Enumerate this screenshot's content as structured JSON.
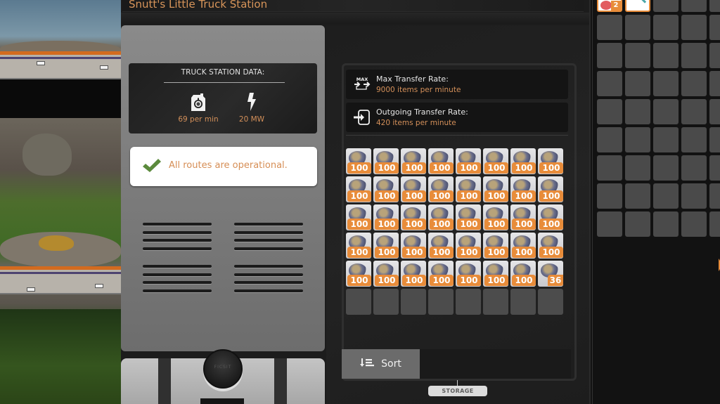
{
  "window": {
    "title": "Snutt's Little Truck Station"
  },
  "station_data": {
    "header": "TRUCK STATION DATA:",
    "fuel": {
      "icon": "fuel-canister-timer-icon",
      "value": "69 per min"
    },
    "power": {
      "icon": "lightning-bolt-icon",
      "value": "20 MW"
    }
  },
  "status": {
    "icon": "checkmark-icon",
    "message": "All routes are operational.",
    "check_color": "#5b8a3c",
    "text_color": "#d68e55"
  },
  "transfer": {
    "max": {
      "icon": "max-transfer-icon",
      "label": "Max Transfer Rate:",
      "value": "9000 items per minute"
    },
    "outgoing": {
      "icon": "outgoing-transfer-icon",
      "label": "Outgoing Transfer Rate:",
      "value": "420 items per minute"
    }
  },
  "storage": {
    "columns": 8,
    "slots": [
      {
        "item": "ore",
        "count": "100"
      },
      {
        "item": "ore",
        "count": "100"
      },
      {
        "item": "ore",
        "count": "100"
      },
      {
        "item": "ore",
        "count": "100"
      },
      {
        "item": "ore",
        "count": "100"
      },
      {
        "item": "ore",
        "count": "100"
      },
      {
        "item": "ore",
        "count": "100"
      },
      {
        "item": "ore",
        "count": "100"
      },
      {
        "item": "ore",
        "count": "100"
      },
      {
        "item": "ore",
        "count": "100"
      },
      {
        "item": "ore",
        "count": "100"
      },
      {
        "item": "ore",
        "count": "100"
      },
      {
        "item": "ore",
        "count": "100"
      },
      {
        "item": "ore",
        "count": "100"
      },
      {
        "item": "ore",
        "count": "100"
      },
      {
        "item": "ore",
        "count": "100"
      },
      {
        "item": "ore",
        "count": "100"
      },
      {
        "item": "ore",
        "count": "100"
      },
      {
        "item": "ore",
        "count": "100"
      },
      {
        "item": "ore",
        "count": "100"
      },
      {
        "item": "ore",
        "count": "100"
      },
      {
        "item": "ore",
        "count": "100"
      },
      {
        "item": "ore",
        "count": "100"
      },
      {
        "item": "ore",
        "count": "100"
      },
      {
        "item": "ore",
        "count": "100"
      },
      {
        "item": "ore",
        "count": "100"
      },
      {
        "item": "ore",
        "count": "100"
      },
      {
        "item": "ore",
        "count": "100"
      },
      {
        "item": "ore",
        "count": "100"
      },
      {
        "item": "ore",
        "count": "100"
      },
      {
        "item": "ore",
        "count": "100"
      },
      {
        "item": "ore",
        "count": "100"
      },
      {
        "item": "ore",
        "count": "100"
      },
      {
        "item": "ore",
        "count": "100"
      },
      {
        "item": "ore",
        "count": "100"
      },
      {
        "item": "ore",
        "count": "100"
      },
      {
        "item": "ore",
        "count": "100"
      },
      {
        "item": "ore",
        "count": "100"
      },
      {
        "item": "ore",
        "count": "100"
      },
      {
        "item": "ore",
        "count": "36"
      },
      {
        "item": null,
        "count": null
      },
      {
        "item": null,
        "count": null
      },
      {
        "item": null,
        "count": null
      },
      {
        "item": null,
        "count": null
      },
      {
        "item": null,
        "count": null
      },
      {
        "item": null,
        "count": null
      },
      {
        "item": null,
        "count": null
      },
      {
        "item": null,
        "count": null
      }
    ],
    "sort_label": "Sort",
    "tag": "STORAGE"
  },
  "inventory": {
    "slots": [
      {
        "item": "meat",
        "count": "2"
      },
      {
        "item": "pickaxe",
        "count": null
      },
      {
        "item": null
      },
      {
        "item": null
      },
      {
        "item": null
      },
      {
        "item": null
      },
      {
        "item": null
      },
      {
        "item": null
      },
      {
        "item": null
      },
      {
        "item": null
      },
      {
        "item": null
      },
      {
        "item": null
      },
      {
        "item": null
      },
      {
        "item": null
      },
      {
        "item": null
      },
      {
        "item": null
      },
      {
        "item": null
      },
      {
        "item": null
      },
      {
        "item": null
      },
      {
        "item": null
      },
      {
        "item": null
      },
      {
        "item": null
      },
      {
        "item": null
      },
      {
        "item": null
      },
      {
        "item": null
      },
      {
        "item": null
      },
      {
        "item": null
      },
      {
        "item": null
      },
      {
        "item": null
      },
      {
        "item": null
      },
      {
        "item": null
      },
      {
        "item": null
      },
      {
        "item": null
      },
      {
        "item": null
      },
      {
        "item": null
      },
      {
        "item": null
      },
      {
        "item": null
      },
      {
        "item": null
      },
      {
        "item": null
      },
      {
        "item": null
      },
      {
        "item": null
      },
      {
        "item": null
      },
      {
        "item": null
      },
      {
        "item": null
      },
      {
        "item": null
      }
    ]
  },
  "colors": {
    "accent": "#e88c3a",
    "value_text": "#d4905a"
  }
}
